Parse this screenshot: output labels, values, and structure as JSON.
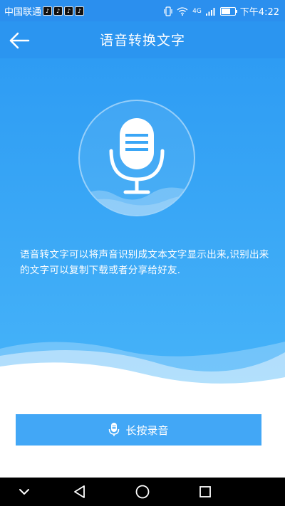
{
  "status_bar": {
    "carrier": "中国联通",
    "time": "下午4:22",
    "signal_label": "4G"
  },
  "header": {
    "title": "语音转换文字"
  },
  "hero": {
    "description": "语音转文字可以将声音识别成文本文字显示出来,识别出来的文字可以复制下载或者分享给好友."
  },
  "record_button": {
    "label": "长按录音"
  },
  "colors": {
    "primary": "#2b95f0",
    "accent": "#42a7f6",
    "status_bar": "#2b8fee"
  },
  "icons": {
    "back": "arrow-left-icon",
    "mic": "microphone-icon",
    "nav_collapse": "chevron-down-icon",
    "nav_back": "triangle-back-icon",
    "nav_home": "circle-home-icon",
    "nav_recent": "square-recent-icon"
  }
}
